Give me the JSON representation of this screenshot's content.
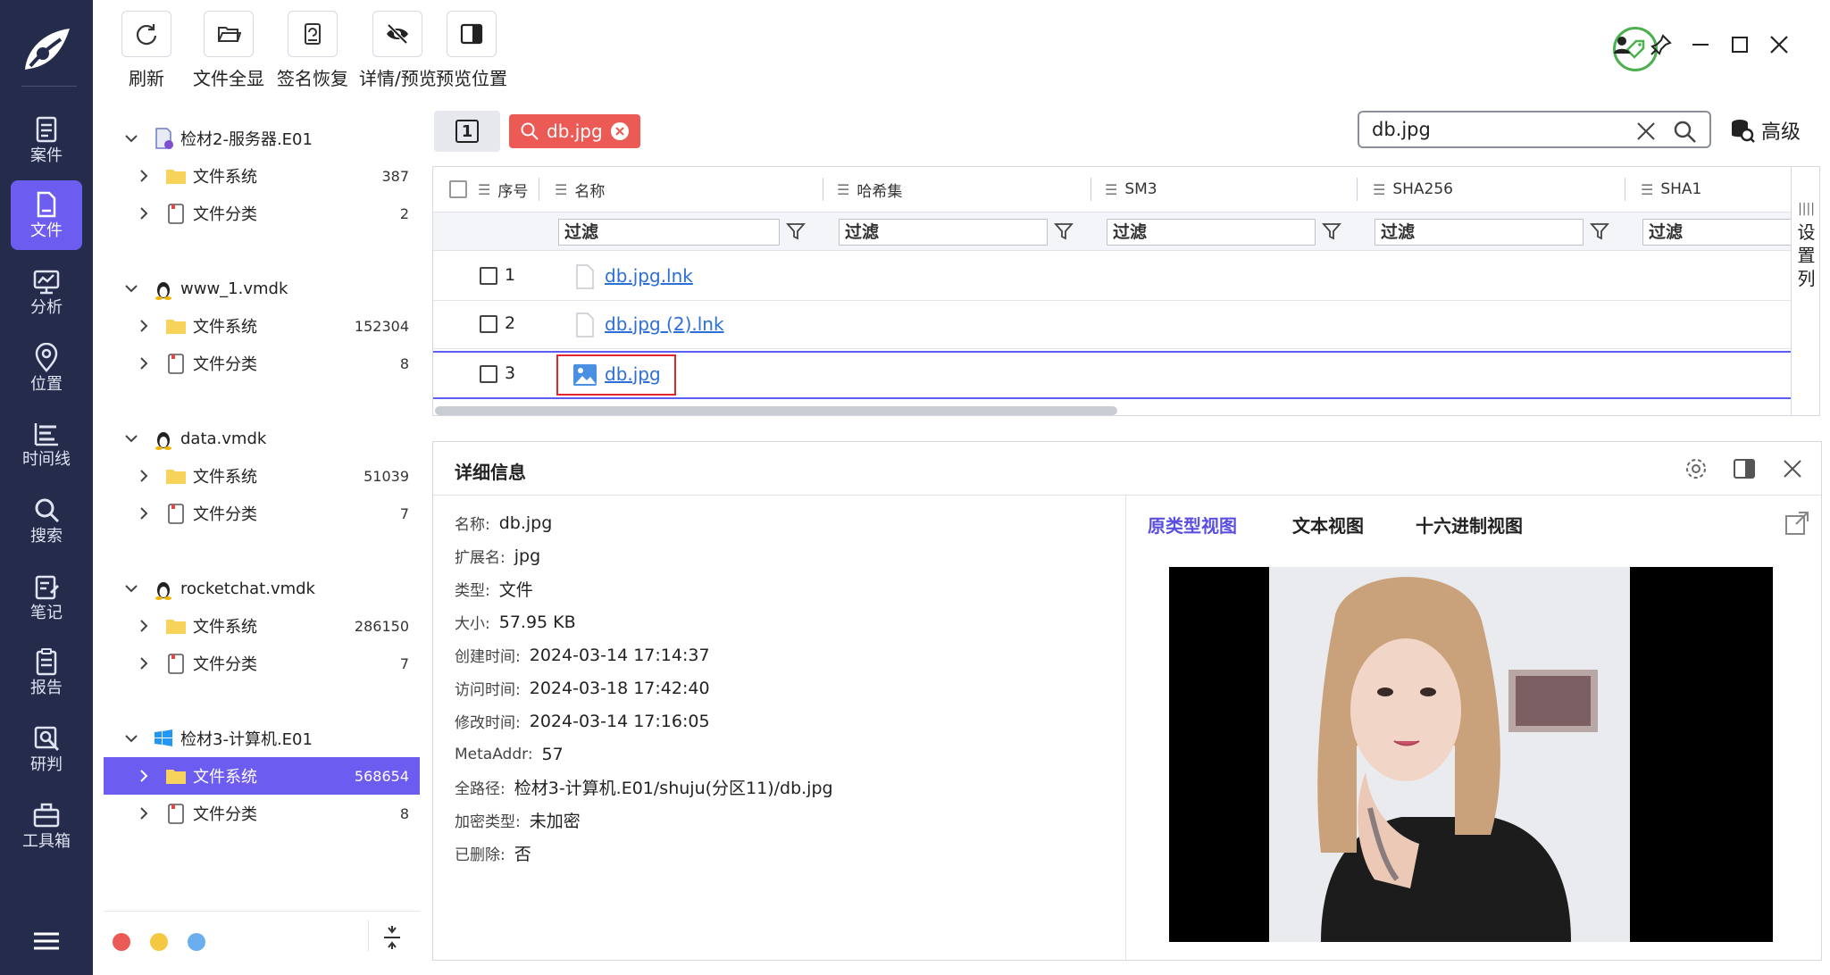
{
  "nav": {
    "items": [
      {
        "label": "案件",
        "icon": "case-icon"
      },
      {
        "label": "文件",
        "icon": "file-icon"
      },
      {
        "label": "分析",
        "icon": "analysis-icon"
      },
      {
        "label": "位置",
        "icon": "location-icon"
      },
      {
        "label": "时间线",
        "icon": "timeline-icon"
      },
      {
        "label": "搜索",
        "icon": "search-icon"
      },
      {
        "label": "笔记",
        "icon": "notes-icon"
      },
      {
        "label": "报告",
        "icon": "report-icon"
      },
      {
        "label": "研判",
        "icon": "judgement-icon"
      },
      {
        "label": "工具箱",
        "icon": "toolbox-icon"
      }
    ],
    "active": "文件",
    "accent": "#6d5cf0",
    "bg": "#242b4b"
  },
  "toolbar": {
    "refresh": "刷新",
    "show_all": "文件全显",
    "signature_recover": "签名恢复",
    "detail_preview": "详情/预览",
    "preview_position": "预览位置"
  },
  "tree": {
    "groups": [
      {
        "name": "检材2-服务器.E01",
        "children": [
          {
            "label": "文件系统",
            "count": "387"
          },
          {
            "label": "文件分类",
            "count": "2"
          }
        ]
      },
      {
        "name": "www_1.vmdk",
        "children": [
          {
            "label": "文件系统",
            "count": "152304"
          },
          {
            "label": "文件分类",
            "count": "8"
          }
        ]
      },
      {
        "name": "data.vmdk",
        "children": [
          {
            "label": "文件系统",
            "count": "51039"
          },
          {
            "label": "文件分类",
            "count": "7"
          }
        ]
      },
      {
        "name": "rocketchat.vmdk",
        "children": [
          {
            "label": "文件系统",
            "count": "286150"
          },
          {
            "label": "文件分类",
            "count": "7"
          }
        ]
      },
      {
        "name": "检材3-计算机.E01",
        "children": [
          {
            "label": "文件系统",
            "count": "568654"
          },
          {
            "label": "文件分类",
            "count": "8"
          }
        ]
      }
    ]
  },
  "tabs": {
    "num_tab": "1",
    "search_tab": "db.jpg"
  },
  "search": {
    "value": "db.jpg",
    "advanced_label": "高级"
  },
  "grid": {
    "columns": [
      "序号",
      "名称",
      "哈希集",
      "SM3",
      "SHA256",
      "SHA1"
    ],
    "filter_placeholder": "过滤",
    "rows": [
      {
        "num": "1",
        "name": "db.jpg.lnk"
      },
      {
        "num": "2",
        "name": "db.jpg (2).lnk"
      },
      {
        "num": "3",
        "name": "db.jpg"
      }
    ],
    "set_columns": "设置列"
  },
  "detail": {
    "title": "详细信息",
    "props": [
      {
        "k": "名称:",
        "v": "db.jpg"
      },
      {
        "k": "扩展名:",
        "v": "jpg"
      },
      {
        "k": "类型:",
        "v": "文件"
      },
      {
        "k": "大小:",
        "v": "57.95 KB"
      },
      {
        "k": "创建时间:",
        "v": "2024-03-14 17:14:37"
      },
      {
        "k": "访问时间:",
        "v": "2024-03-18 17:42:40"
      },
      {
        "k": "修改时间:",
        "v": "2024-03-14 17:16:05"
      },
      {
        "k": "MetaAddr:",
        "v": "57"
      },
      {
        "k": "全路径:",
        "v": "检材3-计算机.E01/shuju(分区11)/db.jpg"
      },
      {
        "k": "加密类型:",
        "v": "未加密"
      },
      {
        "k": "已删除:",
        "v": "否"
      }
    ],
    "preview_tabs": [
      "原类型视图",
      "文本视图",
      "十六进制视图"
    ]
  }
}
